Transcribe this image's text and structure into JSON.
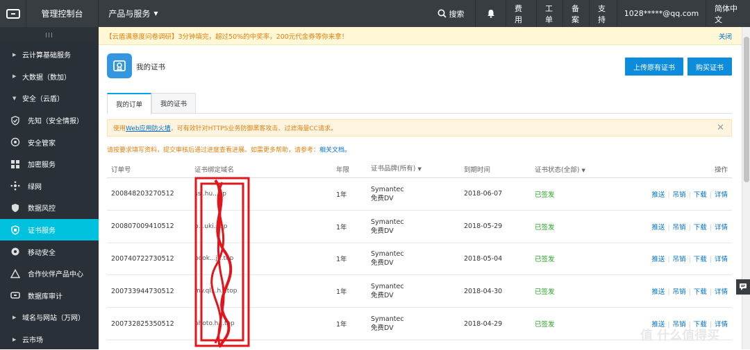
{
  "topbar": {
    "console": "管理控制台",
    "products": "产品与服务",
    "search": "搜索",
    "fees": "费用",
    "ticket": "工单",
    "record": "备案",
    "support": "支持",
    "account": "1028*****@qq.com",
    "lang": "简体中文"
  },
  "sidebar": {
    "collapse": "III",
    "groups": [
      {
        "label": "云计算基础服务"
      },
      {
        "label": "大数据（数加）"
      },
      {
        "label": "安全（云盾）"
      }
    ],
    "items": [
      {
        "label": "先知（安全情报）",
        "icon": "shield-check-icon"
      },
      {
        "label": "安全管家",
        "icon": "gear-icon"
      },
      {
        "label": "加密服务",
        "icon": "windows-icon"
      },
      {
        "label": "绿网",
        "icon": "network-icon"
      },
      {
        "label": "数据风控",
        "icon": "shield-icon"
      },
      {
        "label": "证书服务",
        "icon": "certificate-icon"
      },
      {
        "label": "移动安全",
        "icon": "mobile-icon"
      },
      {
        "label": "合作伙伴产品中心",
        "icon": "triangle-icon"
      },
      {
        "label": "数据库审计",
        "icon": "link-icon"
      }
    ],
    "groups2": [
      {
        "label": "域名与网站（万网）"
      },
      {
        "label": "云市场"
      }
    ]
  },
  "notice": {
    "text": "【云盾满意度问卷调研】3分钟填完，超过50%的中奖率，200元代金券等你来拿！",
    "close": "关闭"
  },
  "header": {
    "title": "我的证书",
    "upload": "上传原有证书",
    "buy": "购买证书"
  },
  "tabs": [
    "我的订单",
    "我的证书"
  ],
  "waf": {
    "pre": "使用",
    "link": "Web应用防火墙",
    "post": "，可有效针对HTTPS业务防御黑客攻击、过滤海量CC请求。"
  },
  "help": {
    "text": "请按要求填写资料，提交审核后通过进度查看进展。如需更多帮助，请参考：",
    "link": "相关文档。"
  },
  "table": {
    "headers": [
      "订单号",
      "证书绑定域名",
      "年限",
      "证书品牌(所有)",
      "到期时间",
      "证书状态(全部)",
      "操作"
    ],
    "ops": [
      "推送",
      "吊销",
      "下载",
      "详情"
    ],
    "rows": [
      {
        "order": "200848203270512",
        "domain": "ssl.hu...op",
        "years": "1年",
        "brand1": "Symantec",
        "brand2": "免费DV",
        "expire": "2018-06-07",
        "status": "已签发"
      },
      {
        "order": "200807009410512",
        "domain": "b...uki...op",
        "years": "1年",
        "brand1": "Symantec",
        "brand2": "免费DV",
        "expire": "2018-05-29",
        "status": "已签发"
      },
      {
        "order": "200740722730512",
        "domain": "book...j...top",
        "years": "1年",
        "brand1": "Symantec",
        "brand2": "免费DV",
        "expire": "2018-05-04",
        "status": "已签发"
      },
      {
        "order": "200733944730512",
        "domain": "my.ql...h...top",
        "years": "1年",
        "brand1": "Symantec",
        "brand2": "免费DV",
        "expire": "2018-04-30",
        "status": "已签发"
      },
      {
        "order": "200732825350512",
        "domain": "photo.h...top",
        "years": "1年",
        "brand1": "Symantec",
        "brand2": "免费DV",
        "expire": "2018-04-29",
        "status": "已签发"
      }
    ]
  },
  "watermark": "值 什么值得买",
  "colors": {
    "topbar": "#373d41",
    "sidebar": "#293038",
    "active": "#00c1de",
    "button": "#0d8cdc",
    "signed": "#23a623",
    "link": "#0070cc",
    "redact": "#e0161c"
  }
}
